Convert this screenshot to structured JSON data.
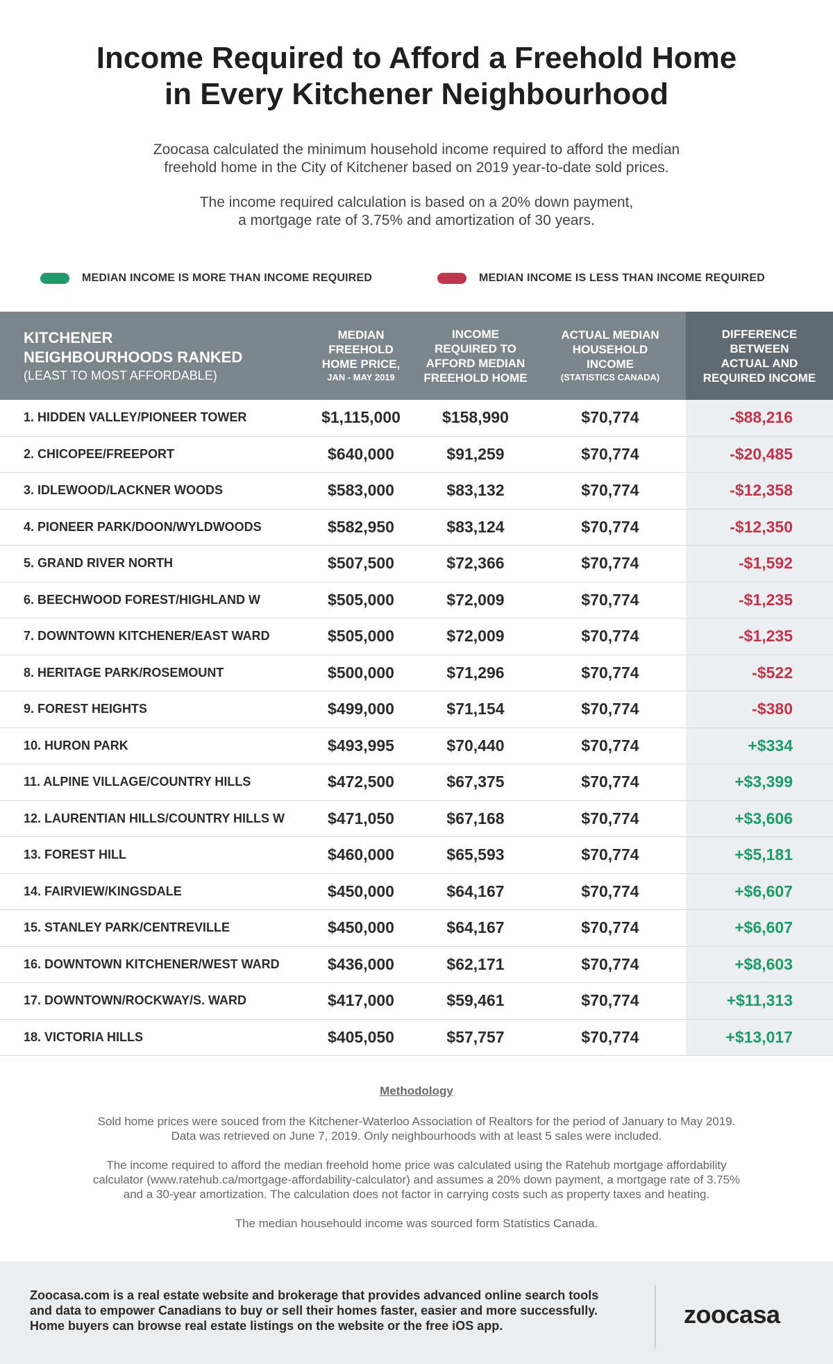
{
  "header": {
    "title_line1": "Income Required to Afford a Freehold Home",
    "title_line2": "in Every Kitchener Neighbourhood",
    "intro1_line1": "Zoocasa calculated the minimum household income required to afford the median",
    "intro1_line2": "freehold home in the City of Kitchener based on 2019 year-to-date sold prices.",
    "intro2_line1": "The income required calculation is based on a 20% down payment,",
    "intro2_line2": "a mortgage rate of 3.75% and amortization of 30 years."
  },
  "legend": {
    "positive_label": "MEDIAN INCOME IS MORE THAN INCOME REQUIRED",
    "negative_label": "MEDIAN INCOME IS LESS THAN INCOME REQUIRED",
    "positive_color": "#1e9a6b",
    "negative_color": "#c0344e"
  },
  "chart_data": {
    "type": "table",
    "columns": [
      {
        "line1": "KITCHENER",
        "line2": "NEIGHBOURHOODS RANKED",
        "sub": "(LEAST TO MOST AFFORDABLE)"
      },
      {
        "lines": [
          "MEDIAN",
          "FREEHOLD",
          "HOME PRICE,"
        ],
        "sub": "JAN - MAY 2019"
      },
      {
        "lines": [
          "INCOME",
          "REQUIRED TO",
          "AFFORD MEDIAN",
          "FREEHOLD HOME"
        ],
        "sub": ""
      },
      {
        "lines": [
          "ACTUAL MEDIAN",
          "HOUSEHOLD",
          "INCOME"
        ],
        "sub": "(STATISTICS CANADA)"
      },
      {
        "lines": [
          "DIFFERENCE",
          "BETWEEN",
          "ACTUAL AND",
          "REQUIRED INCOME"
        ],
        "sub": ""
      }
    ],
    "rows": [
      {
        "name": "1. HIDDEN VALLEY/PIONEER TOWER",
        "price": "$1,115,000",
        "required": "$158,990",
        "actual": "$70,774",
        "difference": "-$88,216"
      },
      {
        "name": "2. CHICOPEE/FREEPORT",
        "price": "$640,000",
        "required": "$91,259",
        "actual": "$70,774",
        "difference": "-$20,485"
      },
      {
        "name": "3. IDLEWOOD/LACKNER WOODS",
        "price": "$583,000",
        "required": "$83,132",
        "actual": "$70,774",
        "difference": "-$12,358"
      },
      {
        "name": "4. PIONEER PARK/DOON/WYLDWOODS",
        "price": "$582,950",
        "required": "$83,124",
        "actual": "$70,774",
        "difference": "-$12,350"
      },
      {
        "name": "5. GRAND RIVER NORTH",
        "price": "$507,500",
        "required": "$72,366",
        "actual": "$70,774",
        "difference": "-$1,592"
      },
      {
        "name": "6. BEECHWOOD FOREST/HIGHLAND W",
        "price": "$505,000",
        "required": "$72,009",
        "actual": "$70,774",
        "difference": "-$1,235"
      },
      {
        "name": "7. DOWNTOWN KITCHENER/EAST WARD",
        "price": "$505,000",
        "required": "$72,009",
        "actual": "$70,774",
        "difference": "-$1,235"
      },
      {
        "name": "8. HERITAGE PARK/ROSEMOUNT",
        "price": "$500,000",
        "required": "$71,296",
        "actual": "$70,774",
        "difference": "-$522"
      },
      {
        "name": "9. FOREST HEIGHTS",
        "price": "$499,000",
        "required": "$71,154",
        "actual": "$70,774",
        "difference": "-$380"
      },
      {
        "name": "10. HURON PARK",
        "price": "$493,995",
        "required": "$70,440",
        "actual": "$70,774",
        "difference": "+$334"
      },
      {
        "name": "11. ALPINE VILLAGE/COUNTRY HILLS",
        "price": "$472,500",
        "required": "$67,375",
        "actual": "$70,774",
        "difference": "+$3,399"
      },
      {
        "name": "12. LAURENTIAN HILLS/COUNTRY HILLS W",
        "price": "$471,050",
        "required": "$67,168",
        "actual": "$70,774",
        "difference": "+$3,606"
      },
      {
        "name": "13. FOREST HILL",
        "price": "$460,000",
        "required": "$65,593",
        "actual": "$70,774",
        "difference": "+$5,181"
      },
      {
        "name": "14. FAIRVIEW/KINGSDALE",
        "price": "$450,000",
        "required": "$64,167",
        "actual": "$70,774",
        "difference": "+$6,607"
      },
      {
        "name": "15. STANLEY PARK/CENTREVILLE",
        "price": "$450,000",
        "required": "$64,167",
        "actual": "$70,774",
        "difference": "+$6,607"
      },
      {
        "name": "16. DOWNTOWN KITCHENER/WEST WARD",
        "price": "$436,000",
        "required": "$62,171",
        "actual": "$70,774",
        "difference": "+$8,603"
      },
      {
        "name": "17. DOWNTOWN/ROCKWAY/S. WARD",
        "price": "$417,000",
        "required": "$59,461",
        "actual": "$70,774",
        "difference": "+$11,313"
      },
      {
        "name": "18. VICTORIA HILLS",
        "price": "$405,050",
        "required": "$57,757",
        "actual": "$70,774",
        "difference": "+$13,017"
      }
    ]
  },
  "methodology": {
    "title": "Methodology",
    "p1_line1": "Sold home prices were souced from the Kitchener-Waterloo Association of Realtors for the period of January to May 2019.",
    "p1_line2": "Data was retrieved on June 7, 2019. Only neighbourhoods with at least 5 sales were included.",
    "p2_line1": "The income required to afford the median freehold home price was calculated using the Ratehub mortgage affordability",
    "p2_line2": "calculator (www.ratehub.ca/mortgage-affordability-calculator) and assumes a 20% down payment, a mortgage rate of 3.75%",
    "p2_line3": "and a 30-year amortization. The calculation does not factor in carrying costs such as property taxes and heating.",
    "p3": "The median househould income was sourced form Statistics Canada."
  },
  "footer": {
    "line1": "Zoocasa.com is a real estate website and brokerage that provides advanced online search tools",
    "line2": "and data to empower Canadians to buy or sell their homes faster, easier and more successfully.",
    "line3": "Home buyers can browse real estate listings on the website or the free iOS app.",
    "logo": "zoocasa"
  }
}
